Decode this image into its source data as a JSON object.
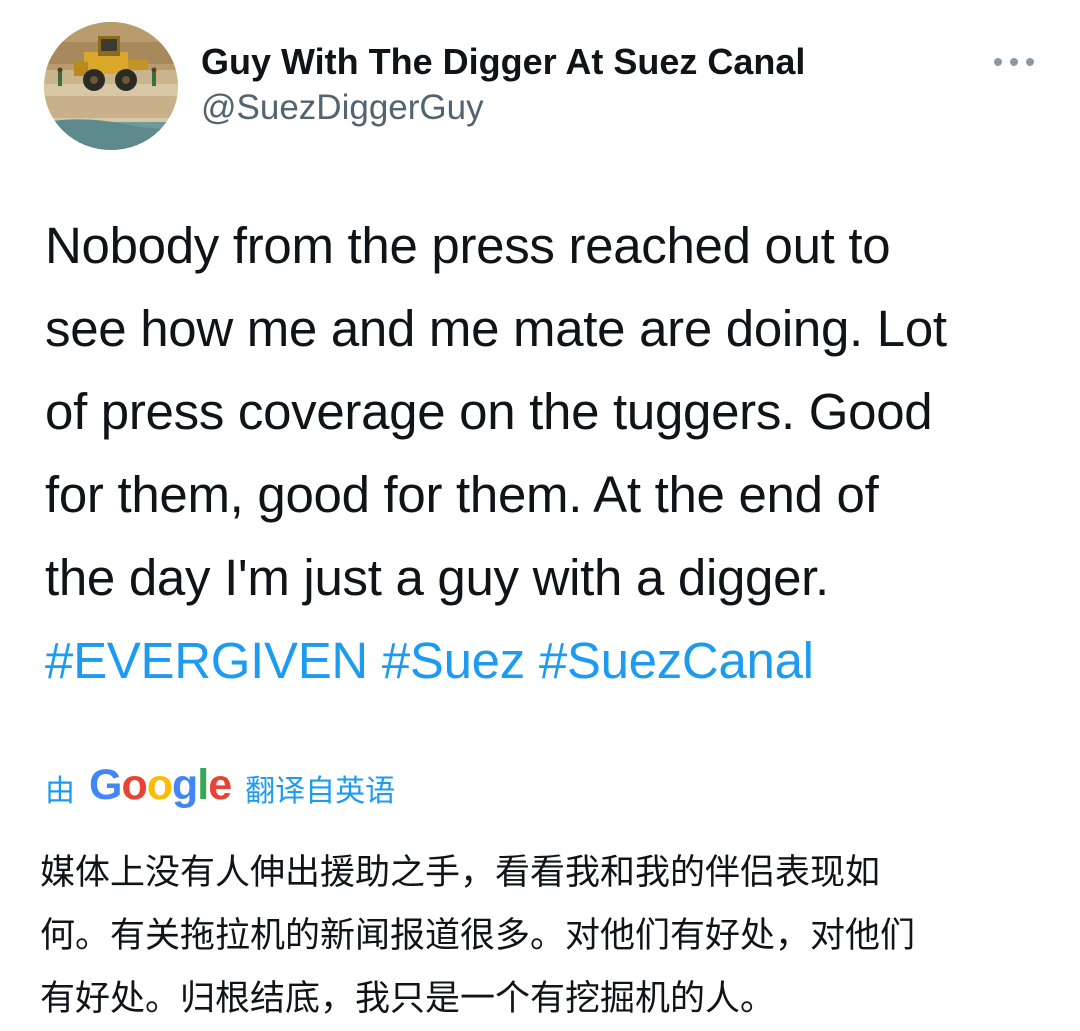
{
  "author": {
    "display_name": "Guy With The Digger At Suez Canal",
    "handle": "@SuezDiggerGuy",
    "avatar_icon": "digger-photo-avatar"
  },
  "more_icon": "ellipsis-icon",
  "tweet": {
    "lines": [
      "Nobody from the press reached out to",
      "see how me and me mate are doing. Lot",
      "of press coverage on the tuggers. Good",
      "for them, good for them. At the end of",
      "the day I'm just a guy with a digger."
    ],
    "hashtags": [
      "#EVERGIVEN",
      "#Suez",
      "#SuezCanal"
    ]
  },
  "translation": {
    "prefix": "由",
    "provider": "Google",
    "suffix": "翻译自英语",
    "lines": [
      "媒体上没有人伸出援助之手，看看我和我的伴侣表现如",
      "何。有关拖拉机的新闻报道很多。对他们有好处，对他们",
      "有好处。归根结底，我只是一个有挖掘机的人。"
    ]
  },
  "colors": {
    "link": "#1d9bf0",
    "text": "#0f1419",
    "secondary": "#536471",
    "google_blue": "#4285f4",
    "google_red": "#ea4335",
    "google_yellow": "#fbbc05",
    "google_green": "#34a853"
  }
}
